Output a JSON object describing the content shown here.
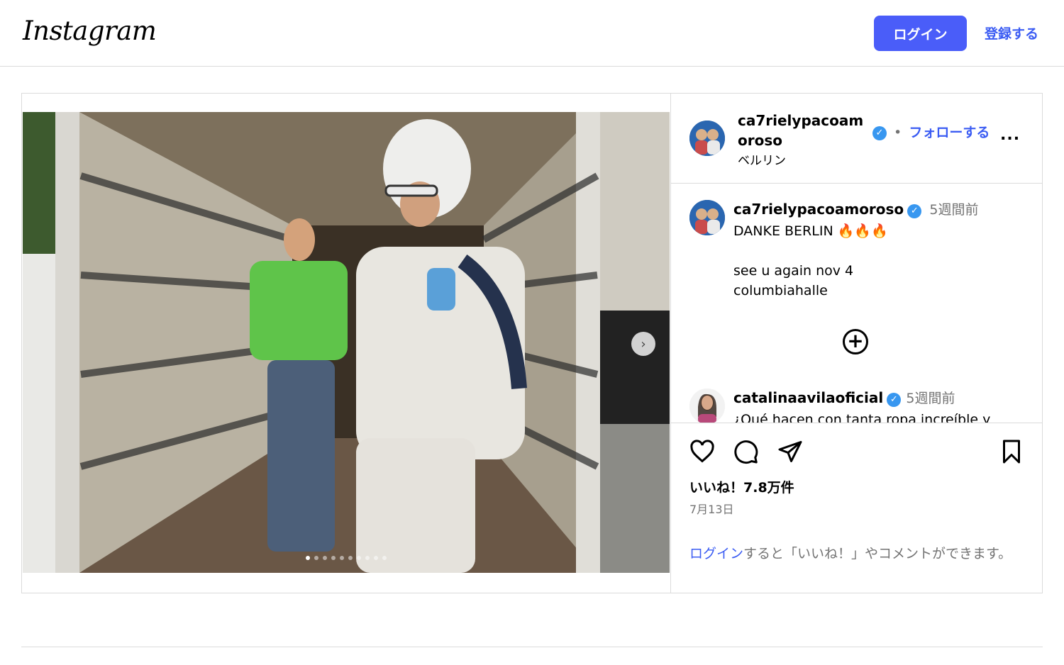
{
  "header": {
    "logo_text": "Instagram",
    "login_label": "ログイン",
    "signup_label": "登録する"
  },
  "post": {
    "username": "ca7rielypacoamoroso",
    "follow_separator": "•",
    "follow_label": "フォローする",
    "location": "ベルリン",
    "more_label": "...",
    "carousel_dots": 10,
    "carousel_active": 0
  },
  "caption": {
    "username": "ca7rielypacoamoroso",
    "time": "5週間前",
    "text": "DANKE BERLIN 🔥🔥🔥\n\nsee u again nov 4\ncolumbiahalle"
  },
  "comments": [
    {
      "username": "catalinaavilaoficial",
      "time": "5週間前",
      "text": "¿Qué hacen con tanta ropa increíble y"
    }
  ],
  "actions": {
    "likes": "いいね！7.8万件",
    "date": "7月13日",
    "login_link": "ログイン",
    "login_rest": "すると「いいね！」やコメントができます。"
  },
  "colors": {
    "accent": "#4a5df9",
    "link": "#3b5cf3",
    "border": "#dbdbdb",
    "muted": "#737373",
    "verified": "#3897f0"
  }
}
